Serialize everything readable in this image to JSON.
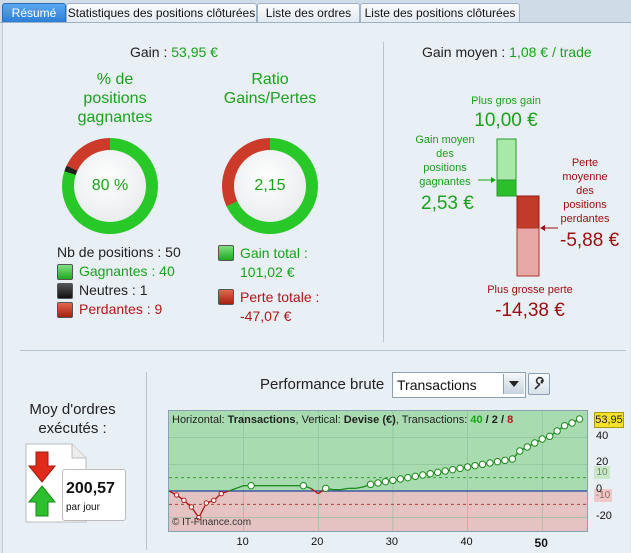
{
  "tabs": [
    {
      "label": "Résumé",
      "active": true
    },
    {
      "label": "Statistiques des positions clôturées",
      "active": false
    },
    {
      "label": "Liste des ordres",
      "active": false
    },
    {
      "label": "Liste des positions clôturées",
      "active": false
    }
  ],
  "summary": {
    "gain_label": "Gain : ",
    "gain_value": "53,95 €",
    "pct_label_1": "% de",
    "pct_label_2": "positions",
    "pct_label_3": "gagnantes",
    "pct_value": "80 %",
    "ratio_label_1": "Ratio",
    "ratio_label_2": "Gains/Pertes",
    "ratio_value": "2,15",
    "nb_positions": "Nb de positions : 50",
    "gagnantes": "Gagnantes : 40",
    "neutres": "Neutres : 1",
    "perdantes": "Perdantes : 9",
    "gain_total_label": "Gain total :",
    "gain_total_value": "101,02 €",
    "perte_totale_label": "Perte totale :",
    "perte_totale_value": "-47,07 €"
  },
  "gain_moyen": {
    "label": "Gain moyen : ",
    "value": "1,08 € / trade",
    "plus_gros_gain_label": "Plus gros gain",
    "plus_gros_gain_value": "10,00 €",
    "gain_moyen_pos_1": "Gain moyen",
    "gain_moyen_pos_2": "des",
    "gain_moyen_pos_3": "positions",
    "gain_moyen_pos_4": "gagnantes",
    "gain_moyen_pos_value": "2,53 €",
    "perte_moyenne_1": "Perte",
    "perte_moyenne_2": "moyenne",
    "perte_moyenne_3": "des",
    "perte_moyenne_4": "positions",
    "perte_moyenne_5": "perdantes",
    "perte_moyenne_value": "-5,88 €",
    "plus_grosse_perte_label": "Plus grosse perte",
    "plus_grosse_perte_value": "-14,38 €"
  },
  "orders": {
    "label_1": "Moy d'ordres",
    "label_2": "exécutés :",
    "value": "200,57",
    "unit": "par jour"
  },
  "performance": {
    "label": "Performance brute",
    "select_value": "Transactions",
    "info_h": "Horizontal: ",
    "info_h_val": "Transactions",
    "info_v": ", Vertical: ",
    "info_v_val": "Devise (€)",
    "info_t": ", Transactions: ",
    "info_t_g": "40",
    "info_sep1": " / ",
    "info_t_n": "2",
    "info_sep2": " / ",
    "info_t_r": "8",
    "watermark": "© IT-Finance.com",
    "last_value_tag": "53,95",
    "pos_band_tag": "10",
    "neg_band_tag": "-10"
  },
  "colors": {
    "accent_blue": "#2d7fd6",
    "green": "#1aa31a",
    "red": "#b01818"
  },
  "chart_data": {
    "type": "line",
    "xlabel": "",
    "ylabel": "",
    "xlim": [
      0,
      56
    ],
    "ylim": [
      -30,
      60
    ],
    "x_ticks": [
      10,
      20,
      30,
      40,
      50
    ],
    "y_ticks": [
      40,
      20,
      0,
      -20
    ],
    "bands": {
      "positive": 10,
      "negative": -10
    },
    "series": [
      {
        "values": [
          0,
          -3,
          -7,
          -12,
          -20,
          -9,
          -7,
          -2,
          0,
          2,
          4,
          4,
          4,
          4,
          4,
          4,
          4,
          4,
          4,
          2,
          -2,
          2,
          1,
          1,
          2,
          2,
          3,
          5,
          6,
          7,
          8,
          9,
          10,
          11,
          12,
          13,
          14,
          15,
          16,
          17,
          18,
          19,
          20,
          21,
          22,
          23,
          24,
          30,
          33,
          36,
          39,
          41,
          45,
          49,
          51,
          54
        ]
      }
    ]
  }
}
